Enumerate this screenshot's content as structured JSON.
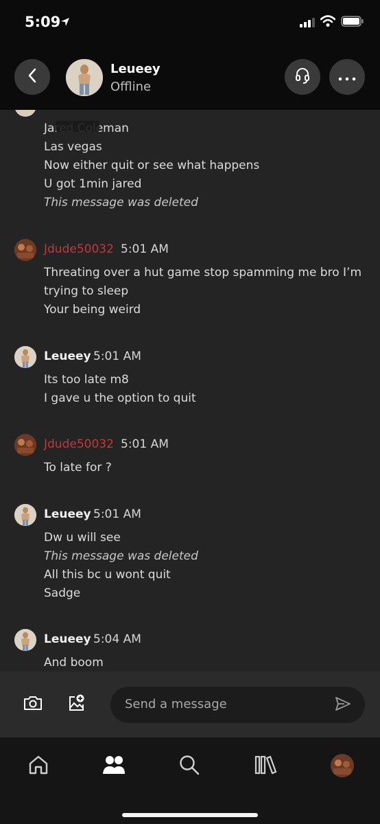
{
  "status_bar": {
    "time": "5:09"
  },
  "header": {
    "contact_name": "Leueey",
    "contact_status": "Offline",
    "back_icon": "chevron-left-icon",
    "call_icon": "headset-icon",
    "more_icon": "more-horizontal-icon"
  },
  "messages": {
    "g1": {
      "lines": [
        "Jared Coleman",
        "Las vegas",
        "Now either quit or see what happens",
        "U got 1min jared",
        "This message was deleted"
      ]
    },
    "g2": {
      "sender": "Jdude50032",
      "time": "5:01 AM",
      "lines": [
        "Threating over a hut game stop spamming me bro I’m",
        "trying to sleep",
        "Your being weird"
      ]
    },
    "g3": {
      "sender": "Leueey",
      "time": "5:01 AM",
      "lines": [
        "Its too late m8",
        "I gave u the option to quit"
      ]
    },
    "g4": {
      "sender": "Jdude50032",
      "time": "5:01 AM",
      "lines": [
        "To late for ?"
      ]
    },
    "g5": {
      "sender": "Leueey",
      "time": "5:01 AM",
      "lines": [
        "Dw u will see",
        "This message was deleted",
        "All this bc u wont quit",
        "Sadge"
      ]
    },
    "g6": {
      "sender": "Leueey",
      "time": "5:04 AM",
      "lines": [
        "And boom"
      ]
    }
  },
  "composer": {
    "placeholder": "Send a message",
    "camera_icon": "camera-icon",
    "image_icon": "add-image-icon",
    "send_icon": "send-icon"
  },
  "bottom_nav": {
    "items": [
      "home-icon",
      "friends-icon",
      "search-icon",
      "library-icon",
      "profile-avatar"
    ]
  },
  "colors": {
    "accent_red": "#c0393b",
    "background": "#242424",
    "header": "#0b0b0b"
  }
}
